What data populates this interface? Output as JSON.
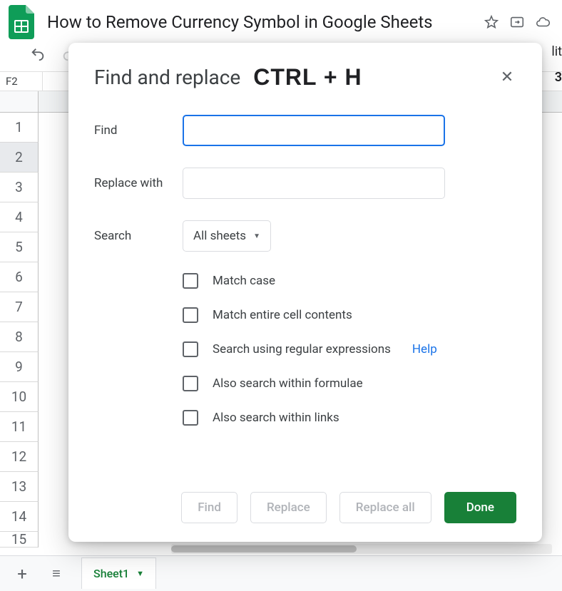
{
  "header": {
    "title": "How to Remove Currency Symbol in Google Sheets"
  },
  "namebox": {
    "value": "F2"
  },
  "rows": [
    "1",
    "2",
    "3",
    "4",
    "5",
    "6",
    "7",
    "8",
    "9",
    "10",
    "11",
    "12",
    "13",
    "14",
    "15"
  ],
  "tabbar": {
    "sheet_name": "Sheet1"
  },
  "dialog": {
    "title": "Find and replace",
    "shortcut": "CTRL + H",
    "labels": {
      "find": "Find",
      "replace": "Replace with",
      "search": "Search"
    },
    "find_value": "",
    "replace_value": "",
    "search_scope": "All sheets",
    "checks": {
      "match_case": "Match case",
      "match_entire": "Match entire cell contents",
      "regex": "Search using regular expressions",
      "formulae": "Also search within formulae",
      "links": "Also search within links"
    },
    "help_label": "Help",
    "buttons": {
      "find": "Find",
      "replace": "Replace",
      "replace_all": "Replace all",
      "done": "Done"
    }
  },
  "clipped": {
    "right_text": "lit",
    "letter": "3"
  }
}
